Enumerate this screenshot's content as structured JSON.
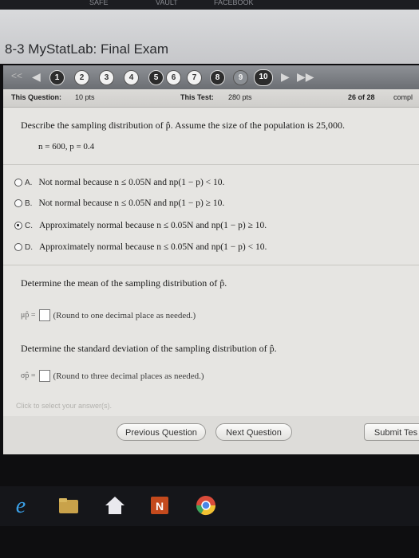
{
  "browser": {
    "bookmarks": [
      "SAFE",
      "VAULT",
      "FACEBOOK"
    ]
  },
  "page": {
    "title": "8-3 MyStatLab: Final Exam"
  },
  "nav": {
    "prev_all": "<<",
    "prev": "◀",
    "next": "▶",
    "next_all": "▶▶",
    "questions": [
      "1",
      "2",
      "3",
      "4",
      "5",
      "6",
      "7",
      "8",
      "9",
      "10"
    ],
    "current": "10"
  },
  "info": {
    "this_question_label": "This Question:",
    "this_question_pts": "10 pts",
    "this_test_label": "This Test:",
    "this_test_pts": "280 pts",
    "progress": "26 of 28",
    "complete": "compl"
  },
  "question": {
    "prompt": "Describe the sampling distribution of p̂. Assume the size of the population is 25,000.",
    "given": "n = 600, p = 0.4"
  },
  "options": [
    {
      "letter": "A.",
      "text": "Not normal because n ≤ 0.05N and np(1 − p) < 10.",
      "checked": false
    },
    {
      "letter": "B.",
      "text": "Not normal because n ≤ 0.05N and np(1 − p) ≥ 10.",
      "checked": false
    },
    {
      "letter": "C.",
      "text": "Approximately normal because n ≤ 0.05N and np(1 − p) ≥ 10.",
      "checked": true
    },
    {
      "letter": "D.",
      "text": "Approximately normal because n ≤ 0.05N and np(1 − p) < 10.",
      "checked": false
    }
  ],
  "mean_part": {
    "prompt": "Determine the mean of the sampling distribution of p̂.",
    "symbol": "μp̂ =",
    "hint": "(Round to one decimal place as needed.)",
    "value": ""
  },
  "sd_part": {
    "prompt": "Determine the standard deviation of the sampling distribution of p̂.",
    "symbol": "σp̂ =",
    "hint": "(Round to three decimal places as needed.)",
    "value": ""
  },
  "footer": {
    "click_hint": "Click to select your answer(s).",
    "prev_button": "Previous Question",
    "next_button": "Next Question",
    "submit_button": "Submit Tes"
  },
  "taskbar": {
    "icons": [
      "ie-icon",
      "folder-icon",
      "home-icon",
      "onenote-icon",
      "chrome-icon"
    ],
    "onenote_letter": "N"
  }
}
